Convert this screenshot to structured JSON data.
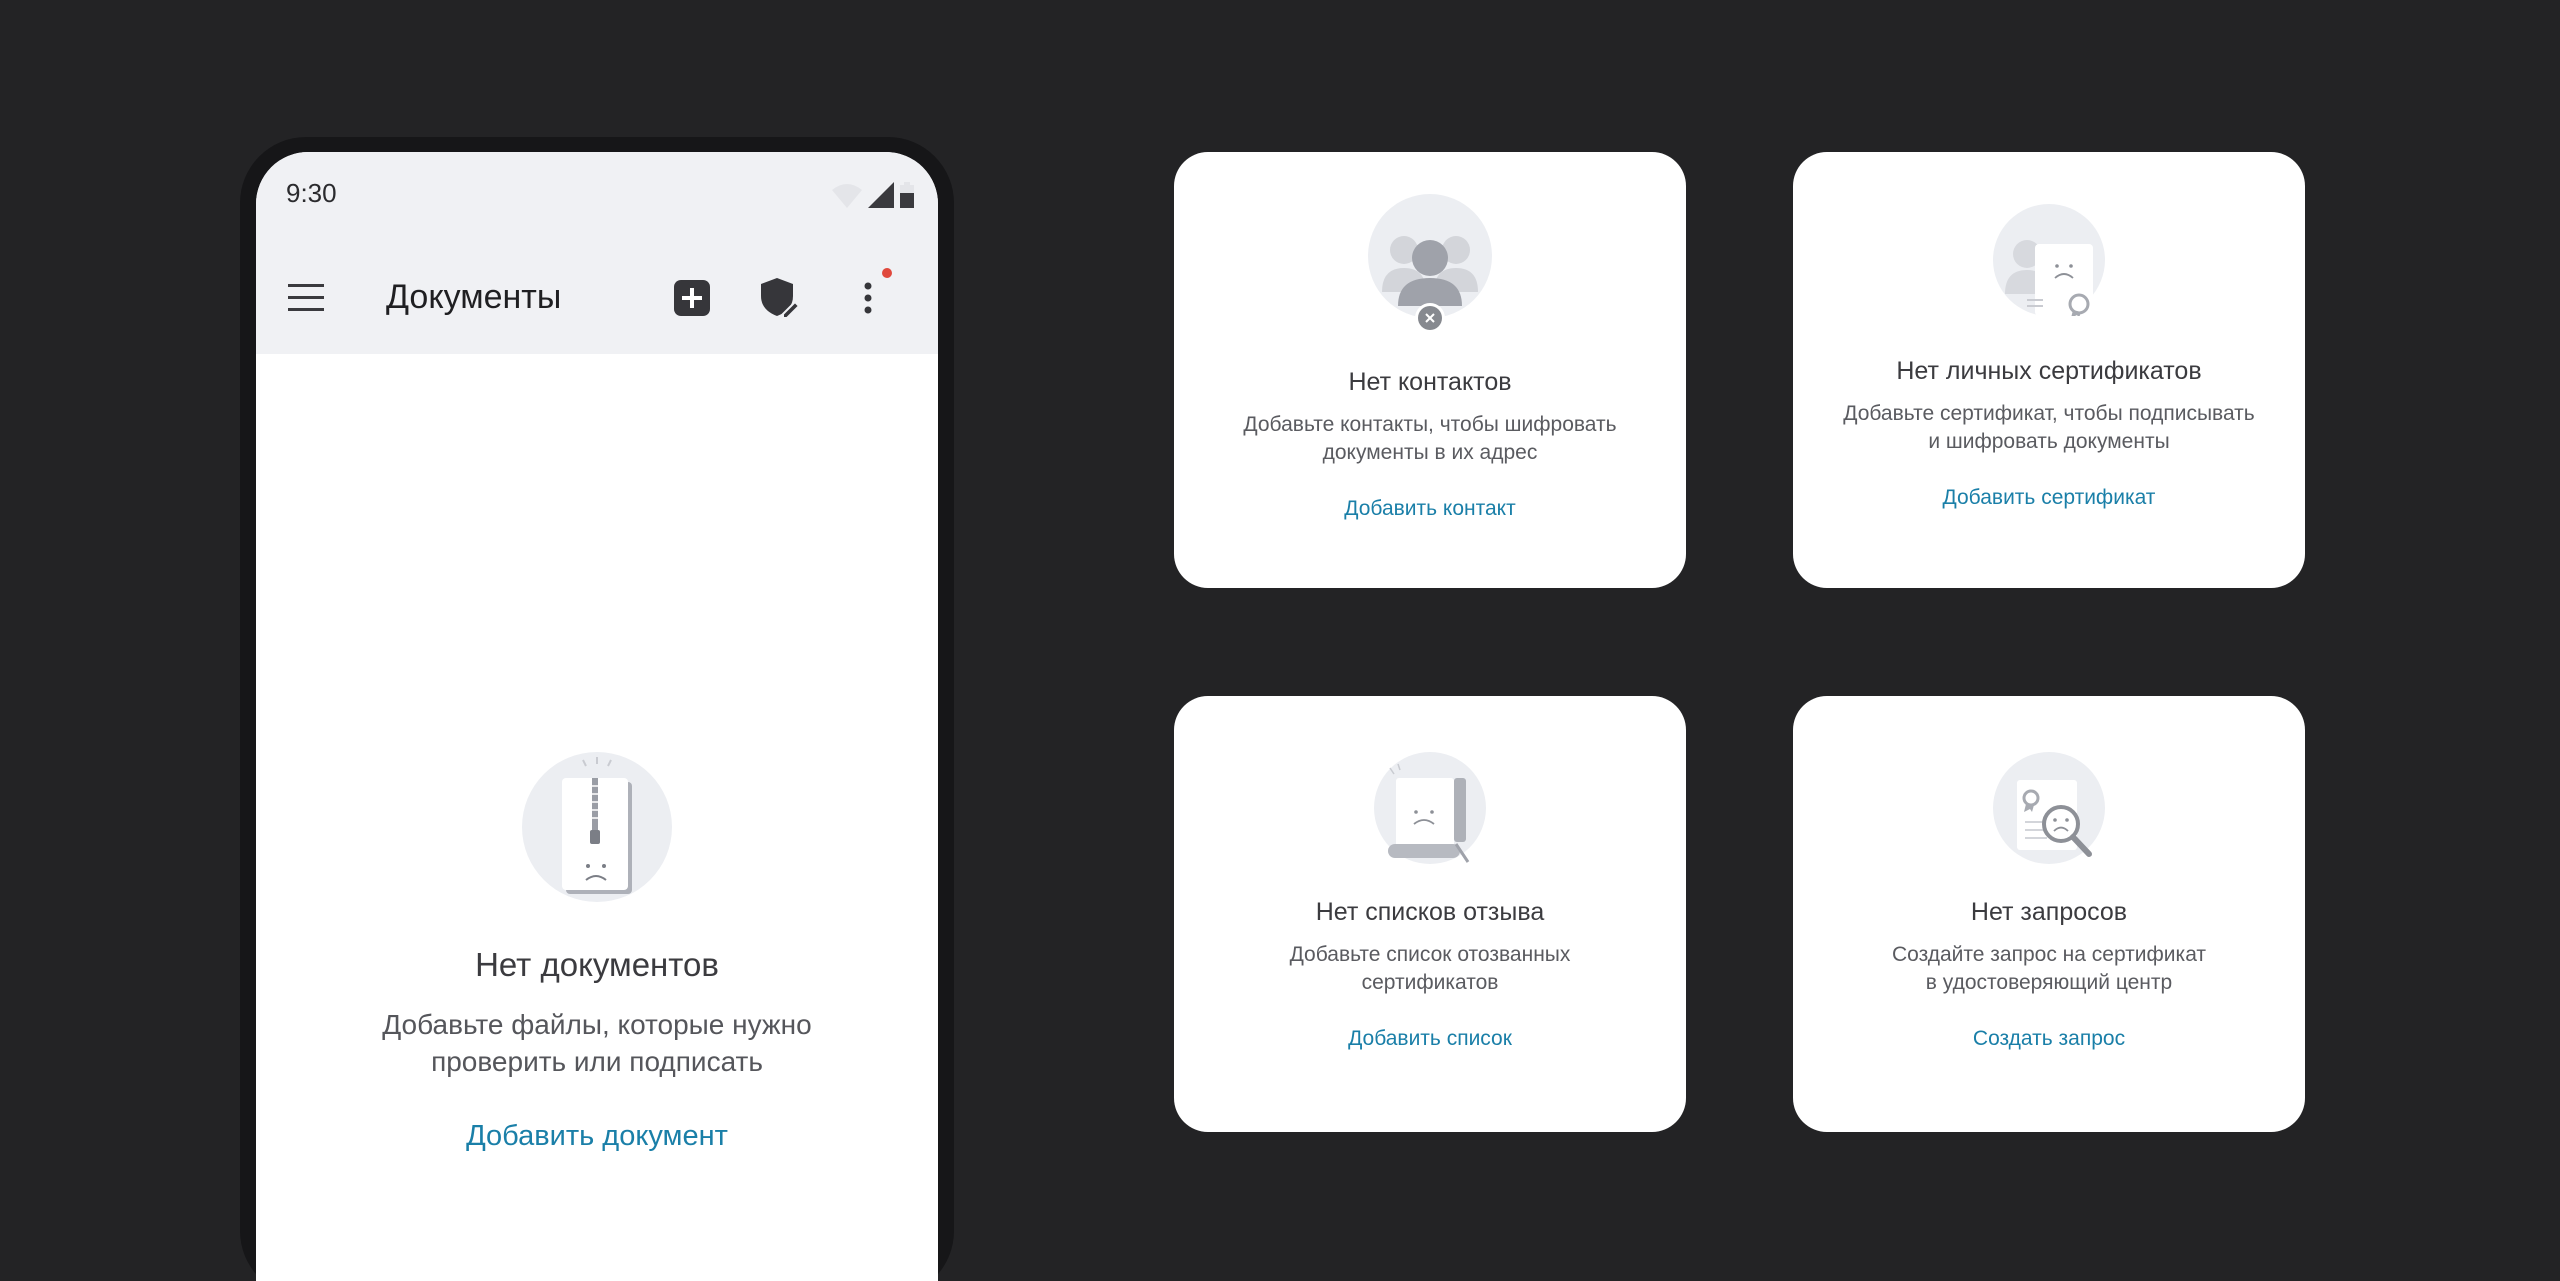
{
  "phone": {
    "status_time": "9:30",
    "app_title": "Документы",
    "icons": {
      "menu": "hamburger-menu-icon",
      "add": "plus-square-icon",
      "shield": "shield-edit-icon",
      "more": "vertical-dots-icon"
    },
    "empty": {
      "title": "Нет документов",
      "subtitle_line1": "Добавьте файлы, которые нужно",
      "subtitle_line2": "проверить или подписать",
      "action": "Добавить документ"
    }
  },
  "cards": {
    "contacts": {
      "title": "Нет контактов",
      "subtitle_line1": "Добавьте контакты, чтобы шифровать",
      "subtitle_line2": "документы в их адрес",
      "action": "Добавить контакт"
    },
    "certificates": {
      "title": "Нет личных сертификатов",
      "subtitle_line1": "Добавьте сертификат, чтобы подписывать",
      "subtitle_line2": "и шифровать документы",
      "action": "Добавить сертификат"
    },
    "revocation": {
      "title": "Нет списков отзыва",
      "subtitle_line1": "Добавьте список отозванных",
      "subtitle_line2": "сертификатов",
      "action": "Добавить список"
    },
    "requests": {
      "title": "Нет запросов",
      "subtitle_line1": "Создайте запрос на сертификат",
      "subtitle_line2": "в удостоверяющий центр",
      "action": "Создать запрос"
    }
  },
  "colors": {
    "background": "#232325",
    "link": "#1a7fa8",
    "notification": "#e0483c"
  }
}
